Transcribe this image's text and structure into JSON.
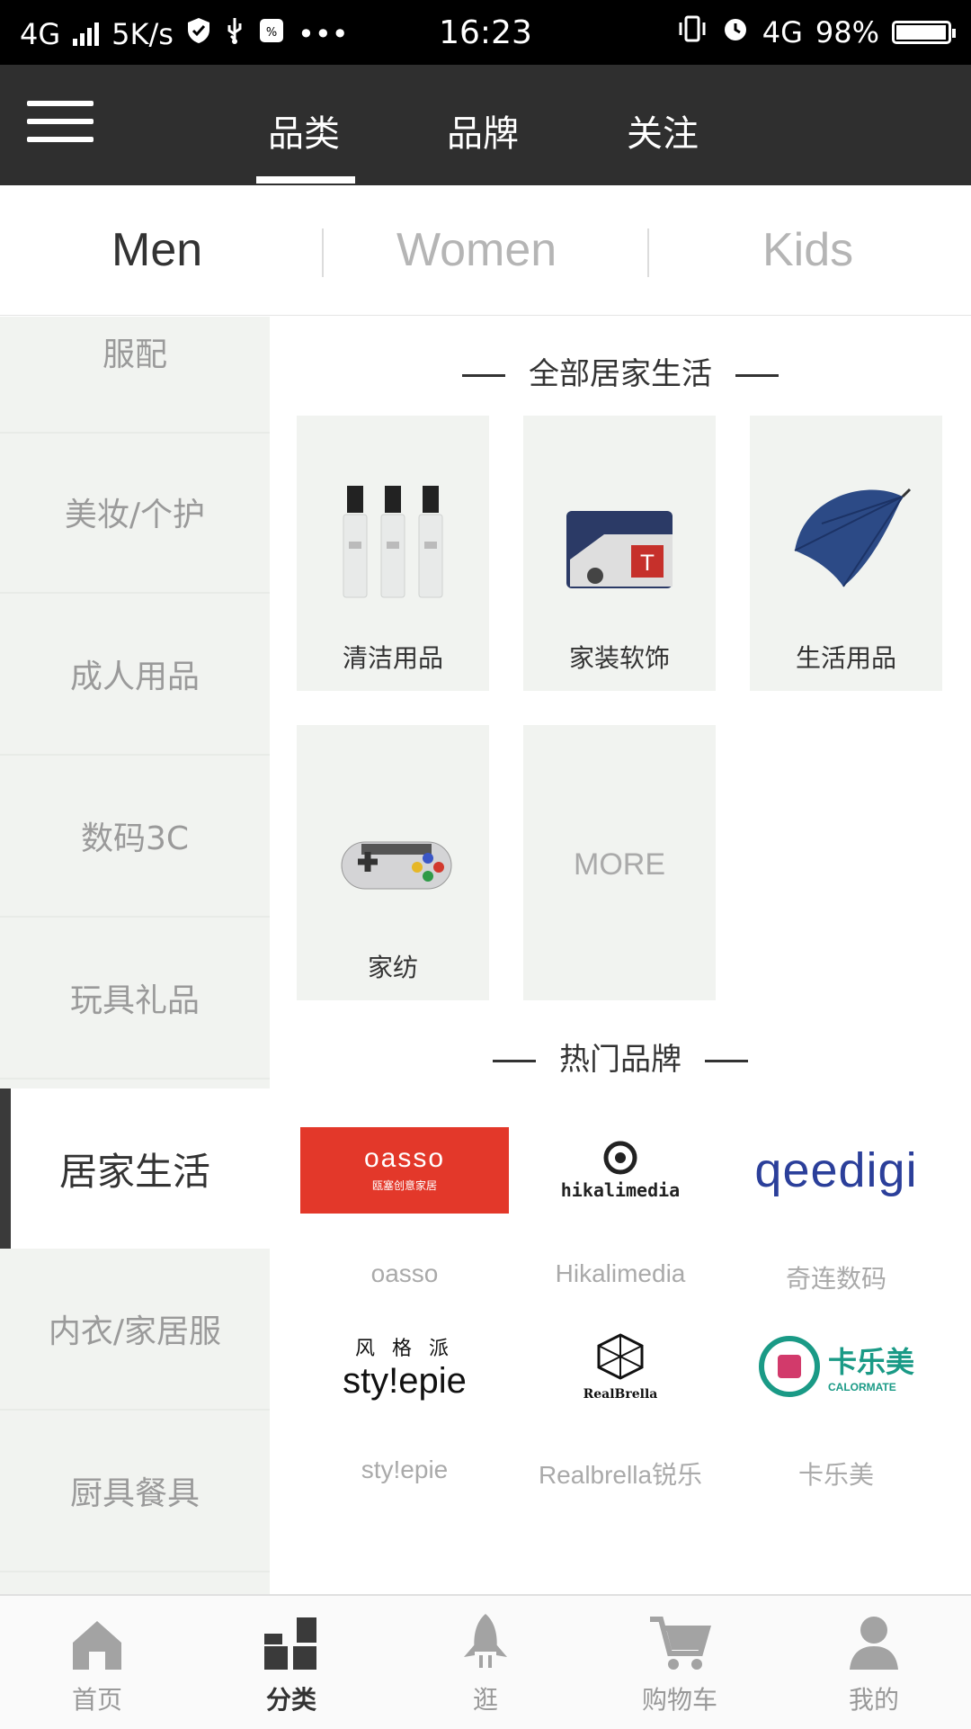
{
  "status_bar": {
    "network": "4G",
    "speed": "5K/s",
    "time": "16:23",
    "network_right": "4G",
    "battery": "98%",
    "battery_level": 0.98
  },
  "top_nav": {
    "tabs": [
      {
        "label": "品类",
        "active": true
      },
      {
        "label": "品牌",
        "active": false
      },
      {
        "label": "关注",
        "active": false
      }
    ]
  },
  "gender_tabs": [
    {
      "label": "Men",
      "active": true
    },
    {
      "label": "Women",
      "active": false
    },
    {
      "label": "Kids",
      "active": false
    }
  ],
  "sidebar": {
    "items": [
      {
        "label": "服配",
        "active": false
      },
      {
        "label": "美妆/个护",
        "active": false
      },
      {
        "label": "成人用品",
        "active": false
      },
      {
        "label": "数码3C",
        "active": false
      },
      {
        "label": "玩具礼品",
        "active": false
      },
      {
        "label": "居家生活",
        "active": true
      },
      {
        "label": "内衣/家居服",
        "active": false
      },
      {
        "label": "厨具餐具",
        "active": false
      }
    ]
  },
  "main": {
    "section_all": "全部居家生活",
    "categories": [
      {
        "label": "清洁用品",
        "icon": "spray-bottles"
      },
      {
        "label": "家装软饰",
        "icon": "cushion"
      },
      {
        "label": "生活用品",
        "icon": "umbrella"
      },
      {
        "label": "家纺",
        "icon": "gamepad-pillow"
      }
    ],
    "more_label": "MORE",
    "section_brands": "热门品牌",
    "brands": [
      {
        "name": "oasso",
        "logo_text": "oasso",
        "logo_sub": "瓯塞创意家居",
        "color": "#e3382a"
      },
      {
        "name": "Hikalimedia",
        "logo_text": "hikalimedia"
      },
      {
        "name": "奇连数码",
        "logo_text": "qeedigi",
        "color": "#2b3f9a"
      },
      {
        "name": "sty!epie",
        "logo_text": "sty!epie",
        "logo_sub": "风 格 派"
      },
      {
        "name": "Realbrella锐乐",
        "logo_text": "RealBrella"
      },
      {
        "name": "卡乐美",
        "logo_text": "卡乐美",
        "logo_sub": "CALORMATE",
        "color": "#1a9a86"
      }
    ]
  },
  "bottom_nav": {
    "items": [
      {
        "label": "首页",
        "icon": "home-icon",
        "active": false
      },
      {
        "label": "分类",
        "icon": "category-icon",
        "active": true
      },
      {
        "label": "逛",
        "icon": "rocket-icon",
        "active": false
      },
      {
        "label": "购物车",
        "icon": "cart-icon",
        "active": false
      },
      {
        "label": "我的",
        "icon": "user-icon",
        "active": false
      }
    ]
  }
}
